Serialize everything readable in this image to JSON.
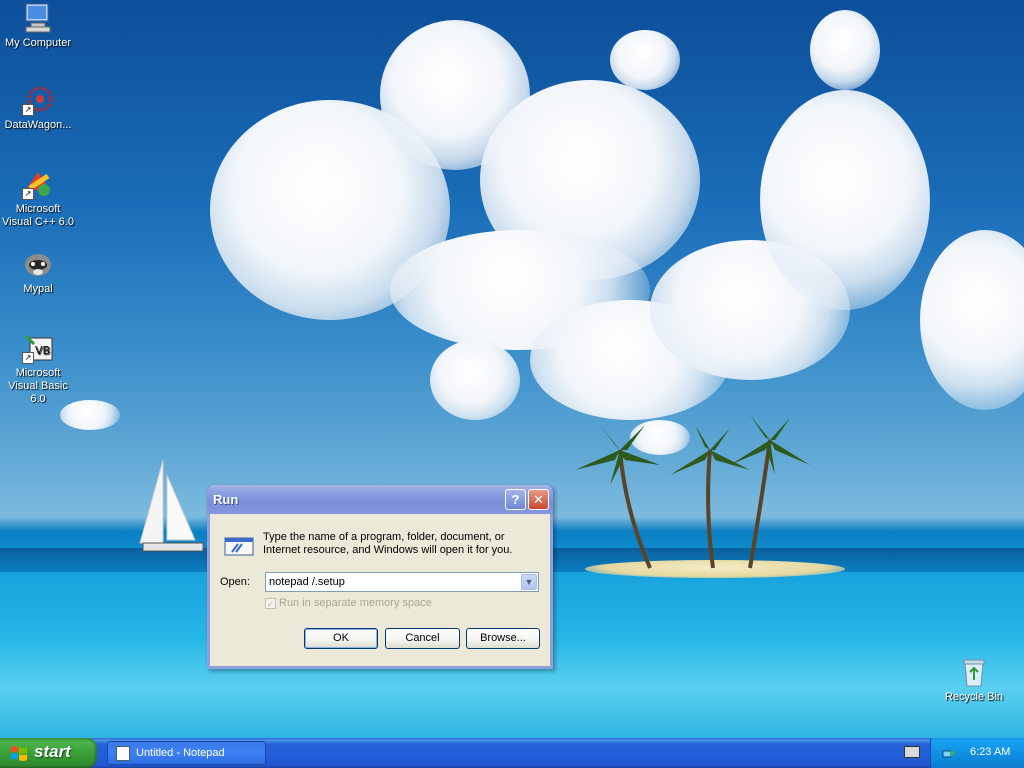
{
  "desktop": {
    "icons": [
      {
        "label": "My Computer",
        "icon": "my-computer-icon"
      },
      {
        "label": "DataWagon...",
        "icon": "datawagon-icon"
      },
      {
        "label": "Microsoft Visual C++ 6.0",
        "icon": "visual-cpp-icon"
      },
      {
        "label": "Mypal",
        "icon": "mypal-icon"
      },
      {
        "label": "Microsoft Visual Basic 6.0",
        "icon": "visual-basic-icon"
      },
      {
        "label": "Recycle Bin",
        "icon": "recycle-bin-icon"
      }
    ]
  },
  "run_dialog": {
    "title": "Run",
    "help_glyph": "?",
    "close_glyph": "✕",
    "description": "Type the name of a program, folder, document, or Internet resource, and Windows will open it for you.",
    "open_label": "Open:",
    "open_value": "notepad /.setup",
    "combo_arrow": "▼",
    "separate_memory_label": "Run in separate memory space",
    "separate_memory_checked": true,
    "separate_memory_enabled": false,
    "check_glyph": "✓",
    "ok_label": "OK",
    "cancel_label": "Cancel",
    "browse_label": "Browse..."
  },
  "taskbar": {
    "start_label": "start",
    "tasks": [
      {
        "label": "Untitled - Notepad",
        "icon": "notepad-icon"
      }
    ],
    "clock": "6:23 AM"
  },
  "colors": {
    "taskbar_blue": "#245edb",
    "start_green": "#3a9f38",
    "dialog_face": "#ece9d8",
    "title_active_blue": "#8ca0e2"
  }
}
